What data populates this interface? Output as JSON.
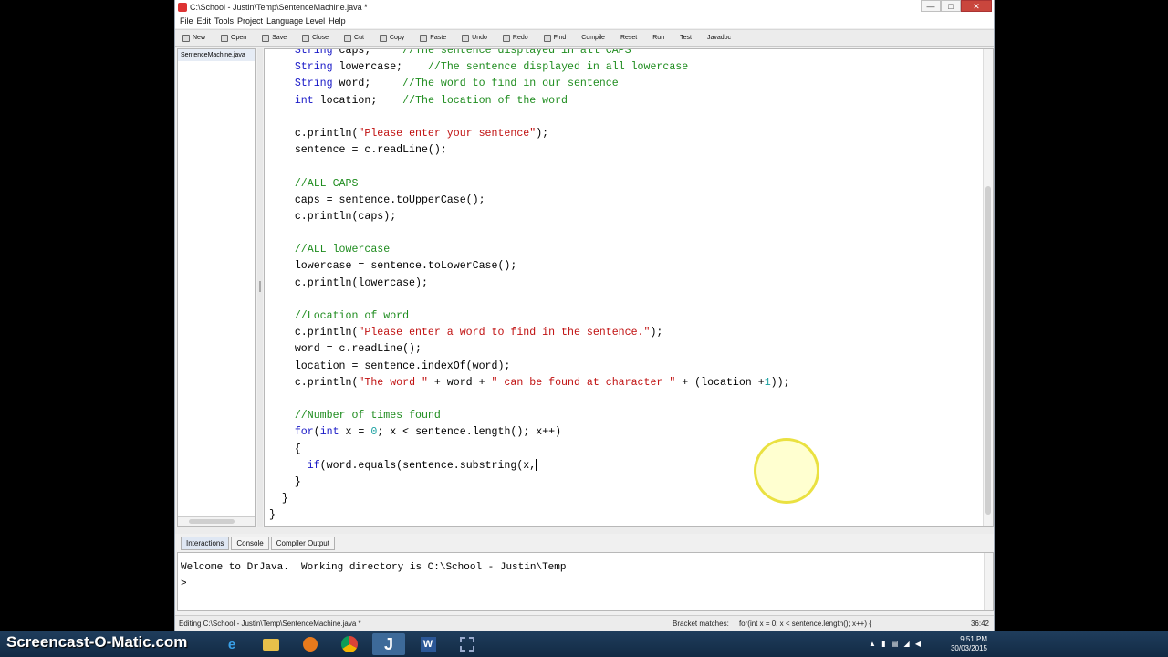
{
  "window": {
    "title": "C:\\School - Justin\\Temp\\SentenceMachine.java *",
    "controls": {
      "minimize": "—",
      "maximize": "□",
      "close": "✕"
    }
  },
  "menu": [
    "File",
    "Edit",
    "Tools",
    "Project",
    "Language Level",
    "Help"
  ],
  "toolbar": [
    "New",
    "Open",
    "Save",
    "Close",
    "Cut",
    "Copy",
    "Paste",
    "Undo",
    "Redo",
    "Find",
    "Compile",
    "Reset",
    "Run",
    "Test",
    "Javadoc"
  ],
  "files": [
    "SentenceMachine.java"
  ],
  "editor": {
    "lines": [
      [
        {
          "t": "    "
        },
        {
          "t": "String",
          "c": "kw"
        },
        {
          "t": " caps;     "
        },
        {
          "t": "//The sentence displayed in all CAPS",
          "c": "cm"
        }
      ],
      [
        {
          "t": "    "
        },
        {
          "t": "String",
          "c": "kw"
        },
        {
          "t": " lowercase;    "
        },
        {
          "t": "//The sentence displayed in all lowercase",
          "c": "cm"
        }
      ],
      [
        {
          "t": "    "
        },
        {
          "t": "String",
          "c": "kw"
        },
        {
          "t": " word;     "
        },
        {
          "t": "//The word to find in our sentence",
          "c": "cm"
        }
      ],
      [
        {
          "t": "    "
        },
        {
          "t": "int",
          "c": "kw"
        },
        {
          "t": " location;    "
        },
        {
          "t": "//The location of the word",
          "c": "cm"
        }
      ],
      [
        {
          "t": ""
        }
      ],
      [
        {
          "t": "    c.println("
        },
        {
          "t": "\"Please enter your sentence\"",
          "c": "st"
        },
        {
          "t": ");"
        }
      ],
      [
        {
          "t": "    sentence = c.readLine();"
        }
      ],
      [
        {
          "t": ""
        }
      ],
      [
        {
          "t": "    "
        },
        {
          "t": "//ALL CAPS",
          "c": "cm"
        }
      ],
      [
        {
          "t": "    caps = sentence.toUpperCase();"
        }
      ],
      [
        {
          "t": "    c.println(caps);"
        }
      ],
      [
        {
          "t": ""
        }
      ],
      [
        {
          "t": "    "
        },
        {
          "t": "//ALL lowercase",
          "c": "cm"
        }
      ],
      [
        {
          "t": "    lowercase = sentence.toLowerCase();"
        }
      ],
      [
        {
          "t": "    c.println(lowercase);"
        }
      ],
      [
        {
          "t": ""
        }
      ],
      [
        {
          "t": "    "
        },
        {
          "t": "//Location of word",
          "c": "cm"
        }
      ],
      [
        {
          "t": "    c.println("
        },
        {
          "t": "\"Please enter a word to find in the sentence.\"",
          "c": "st"
        },
        {
          "t": ");"
        }
      ],
      [
        {
          "t": "    word = c.readLine();"
        }
      ],
      [
        {
          "t": "    location = sentence.indexOf(word);"
        }
      ],
      [
        {
          "t": "    c.println("
        },
        {
          "t": "\"The word \"",
          "c": "st"
        },
        {
          "t": " + word + "
        },
        {
          "t": "\" can be found at character \"",
          "c": "st"
        },
        {
          "t": " + (location +"
        },
        {
          "t": "1",
          "c": "nm"
        },
        {
          "t": "));"
        }
      ],
      [
        {
          "t": ""
        }
      ],
      [
        {
          "t": "    "
        },
        {
          "t": "//Number of times found",
          "c": "cm"
        }
      ],
      [
        {
          "t": "    "
        },
        {
          "t": "for",
          "c": "kw"
        },
        {
          "t": "("
        },
        {
          "t": "int",
          "c": "kw"
        },
        {
          "t": " x = "
        },
        {
          "t": "0",
          "c": "nm"
        },
        {
          "t": "; x < sentence.length(); x++)"
        }
      ],
      [
        {
          "t": "    {"
        }
      ],
      [
        {
          "t": "      "
        },
        {
          "t": "if",
          "c": "kw"
        },
        {
          "t": "(word.equals(sentence.substring(x,"
        },
        {
          "t": "",
          "caret": true
        }
      ],
      [
        {
          "t": "    }"
        }
      ],
      [
        {
          "t": "  }"
        }
      ],
      [
        {
          "t": "}"
        }
      ]
    ]
  },
  "bottom_tabs": [
    "Interactions",
    "Console",
    "Compiler Output"
  ],
  "interactions": {
    "welcome": "Welcome to DrJava.  Working directory is C:\\School - Justin\\Temp",
    "prompt": ">"
  },
  "status": {
    "editing": "Editing C:\\School - Justin\\Temp\\SentenceMachine.java *",
    "bracket_label": "Bracket matches:",
    "bracket_value": "for(int x = 0; x < sentence.length(); x++) {",
    "position": "36:42"
  },
  "taskbar": {
    "watermark": "Screencast-O-Matic.com",
    "time": "9:51 PM",
    "date": "30/03/2015"
  }
}
